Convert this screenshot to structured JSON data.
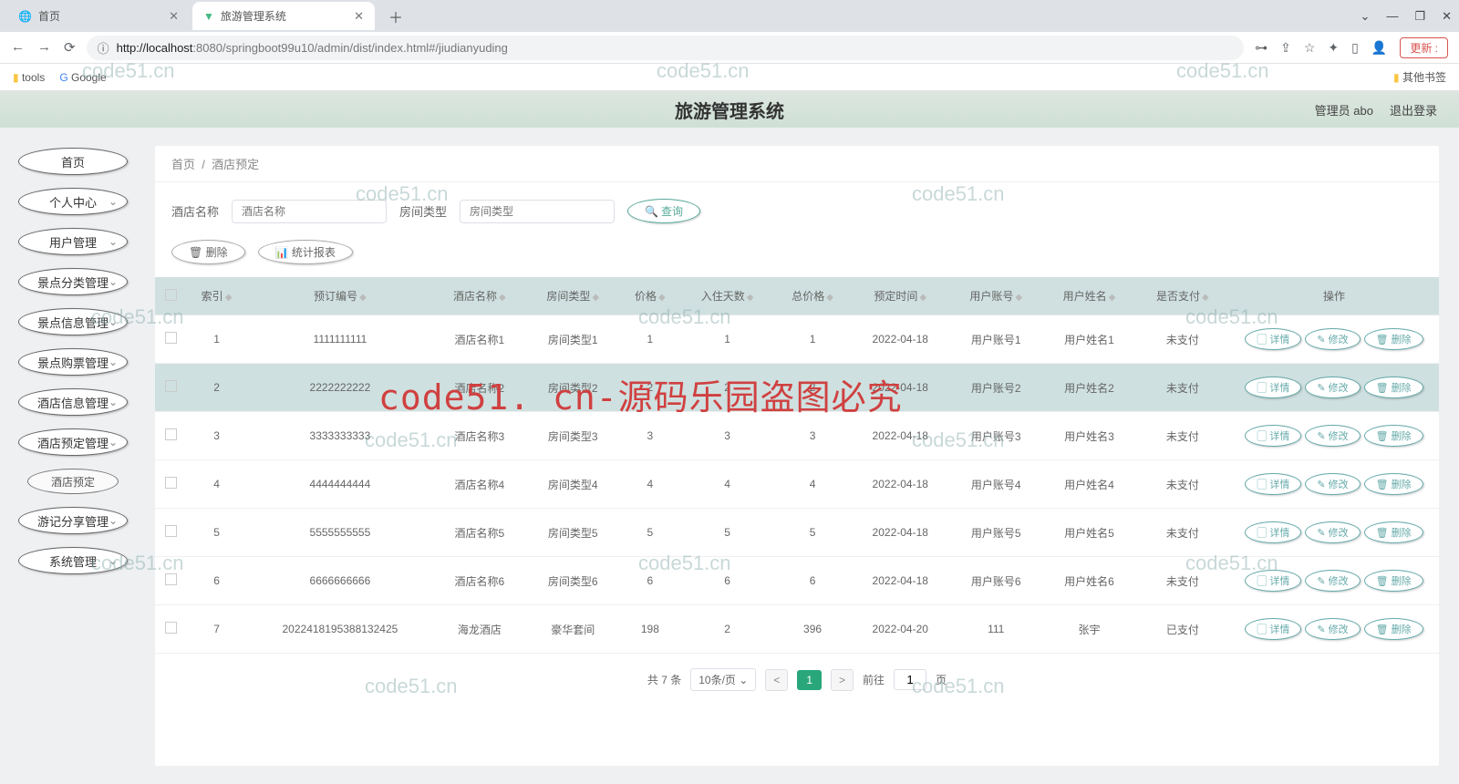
{
  "browser": {
    "tab1": "首页",
    "tab2": "旅游管理系统",
    "url_proto": "ⓘ",
    "url_host": "http://localhost",
    "url_port": ":8080",
    "url_path": "/springboot99u10/admin/dist/index.html#/jiudianyuding",
    "update": "更新",
    "bm_tools": "tools",
    "bm_google": "Google",
    "bm_other": "其他书签"
  },
  "header": {
    "title": "旅游管理系统",
    "user": "管理员 abo",
    "logout": "退出登录"
  },
  "sidebar": [
    {
      "label": "首页",
      "chev": false
    },
    {
      "label": "个人中心",
      "chev": true
    },
    {
      "label": "用户管理",
      "chev": true
    },
    {
      "label": "景点分类管理",
      "chev": true
    },
    {
      "label": "景点信息管理",
      "chev": true
    },
    {
      "label": "景点购票管理",
      "chev": true
    },
    {
      "label": "酒店信息管理",
      "chev": true
    },
    {
      "label": "酒店预定管理",
      "chev": true,
      "sub": "酒店预定"
    },
    {
      "label": "游记分享管理",
      "chev": true
    },
    {
      "label": "系统管理",
      "chev": true
    }
  ],
  "bc": {
    "home": "首页",
    "sep": "/",
    "page": "酒店预定"
  },
  "filters": {
    "f1": "酒店名称",
    "ph1": "酒店名称",
    "f2": "房间类型",
    "ph2": "房间类型",
    "query": "查询",
    "del": "删除",
    "stat": "统计报表"
  },
  "cols": [
    "",
    "索引",
    "预订编号",
    "酒店名称",
    "房间类型",
    "价格",
    "入住天数",
    "总价格",
    "预定时间",
    "用户账号",
    "用户姓名",
    "是否支付",
    "操作"
  ],
  "ops": {
    "detail": "详情",
    "edit": "修改",
    "del": "删除"
  },
  "rows": [
    {
      "idx": "1",
      "no": "1111111111",
      "hotel": "酒店名称1",
      "room": "房间类型1",
      "price": "1",
      "days": "1",
      "total": "1",
      "time": "2022-04-18",
      "acc": "用户账号1",
      "uname": "用户姓名1",
      "pay": "未支付"
    },
    {
      "idx": "2",
      "no": "2222222222",
      "hotel": "酒店名称2",
      "room": "房间类型2",
      "price": "2",
      "days": "2",
      "total": "2",
      "time": "2022-04-18",
      "acc": "用户账号2",
      "uname": "用户姓名2",
      "pay": "未支付",
      "sel": true
    },
    {
      "idx": "3",
      "no": "3333333333",
      "hotel": "酒店名称3",
      "room": "房间类型3",
      "price": "3",
      "days": "3",
      "total": "3",
      "time": "2022-04-18",
      "acc": "用户账号3",
      "uname": "用户姓名3",
      "pay": "未支付"
    },
    {
      "idx": "4",
      "no": "4444444444",
      "hotel": "酒店名称4",
      "room": "房间类型4",
      "price": "4",
      "days": "4",
      "total": "4",
      "time": "2022-04-18",
      "acc": "用户账号4",
      "uname": "用户姓名4",
      "pay": "未支付"
    },
    {
      "idx": "5",
      "no": "5555555555",
      "hotel": "酒店名称5",
      "room": "房间类型5",
      "price": "5",
      "days": "5",
      "total": "5",
      "time": "2022-04-18",
      "acc": "用户账号5",
      "uname": "用户姓名5",
      "pay": "未支付"
    },
    {
      "idx": "6",
      "no": "6666666666",
      "hotel": "酒店名称6",
      "room": "房间类型6",
      "price": "6",
      "days": "6",
      "total": "6",
      "time": "2022-04-18",
      "acc": "用户账号6",
      "uname": "用户姓名6",
      "pay": "未支付"
    },
    {
      "idx": "7",
      "no": "2022418195388132425",
      "hotel": "海龙酒店",
      "room": "豪华套间",
      "price": "198",
      "days": "2",
      "total": "396",
      "time": "2022-04-20",
      "acc": "111",
      "uname": "张宇",
      "pay": "已支付"
    }
  ],
  "pager": {
    "total": "共 7 条",
    "perpage": "10条/页",
    "cur": "1",
    "jump_pre": "前往",
    "jump_val": "1",
    "jump_suf": "页"
  },
  "wm": {
    "t": "code51.cn",
    "big": "code51. cn-源码乐园盗图必究"
  }
}
